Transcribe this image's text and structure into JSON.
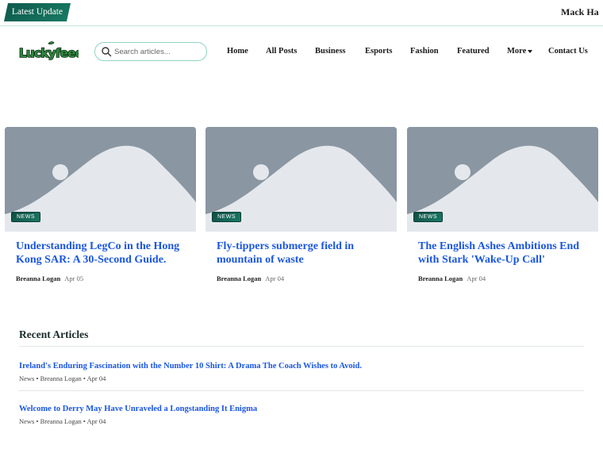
{
  "ticker": {
    "label": "Latest Update",
    "text": "Mack Ha"
  },
  "header": {
    "logo_text": "Luckyfeed",
    "search_placeholder": "Search articles...",
    "nav": [
      "Home",
      "All Posts",
      "Business",
      "Esports",
      "Fashion",
      "Featured",
      "More",
      "Contact Us"
    ]
  },
  "featured": [
    {
      "badge": "NEWS",
      "title": "Understanding LegCo in the Hong Kong SAR: A 30-Second Guide.",
      "author": "Breanna Logan",
      "date": "Apr 05"
    },
    {
      "badge": "NEWS",
      "title": "Fly-tippers submerge field in mountain of waste",
      "author": "Breanna Logan",
      "date": "Apr 04"
    },
    {
      "badge": "NEWS",
      "title": "The English Ashes Ambitions End with Stark 'Wake-Up Call'",
      "author": "Breanna Logan",
      "date": "Apr 04"
    }
  ],
  "recent": {
    "heading": "Recent Articles",
    "items": [
      {
        "title": "Ireland's Enduring Fascination with the Number 10 Shirt: A Drama The Coach Wishes to Avoid.",
        "meta": "News • Breanna Logan • Apr 04"
      },
      {
        "title": "Welcome to Derry May Have Unraveled a Longstanding It Enigma",
        "meta": "News • Breanna Logan • Apr 04"
      }
    ]
  },
  "colors": {
    "brand": "#0f5e4f",
    "link": "#1a56e0",
    "accent_border": "#8fd3c2",
    "placeholder": "#8a96a2"
  },
  "icons": {
    "search": "search-icon",
    "more": "chevron-down-icon"
  }
}
